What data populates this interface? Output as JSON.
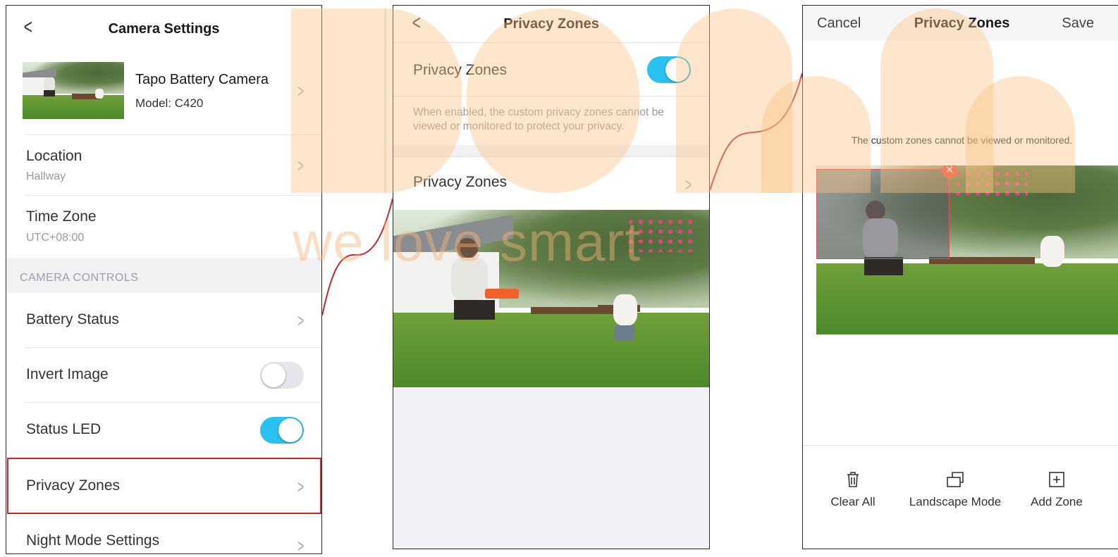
{
  "screen1": {
    "title": "Camera Settings",
    "device": {
      "name": "Tapo Battery Camera",
      "model": "Model: C420"
    },
    "location": {
      "label": "Location",
      "value": "Hallway"
    },
    "timezone": {
      "label": "Time Zone",
      "value": "UTC+08:00"
    },
    "section_header": "CAMERA CONTROLS",
    "battery_status": "Battery Status",
    "invert_image": {
      "label": "Invert Image",
      "on": false
    },
    "status_led": {
      "label": "Status LED",
      "on": true
    },
    "privacy_zones": "Privacy Zones",
    "night_mode": "Night Mode Settings"
  },
  "screen2": {
    "title": "Privacy Zones",
    "toggle_label": "Privacy Zones",
    "toggle_on": true,
    "description": "When enabled, the custom privacy zones cannot be viewed or monitored to protect your privacy.",
    "link_label": "Privacy Zones"
  },
  "screen3": {
    "cancel": "Cancel",
    "title": "Privacy Zones",
    "save": "Save",
    "notice": "The custom zones cannot be viewed or monitored.",
    "tools": {
      "clear_all": "Clear All",
      "landscape_mode": "Landscape Mode",
      "add_zone": "Add Zone"
    }
  },
  "watermark": {
    "text": "we love smart"
  },
  "colors": {
    "accent": "#29c2f0",
    "highlight": "#d0242a",
    "zone_delete": "#f04e3e"
  },
  "icons": [
    "back-chevron-icon",
    "chevron-right-icon",
    "trash-icon",
    "landscape-icon",
    "add-zone-icon",
    "close-icon"
  ]
}
